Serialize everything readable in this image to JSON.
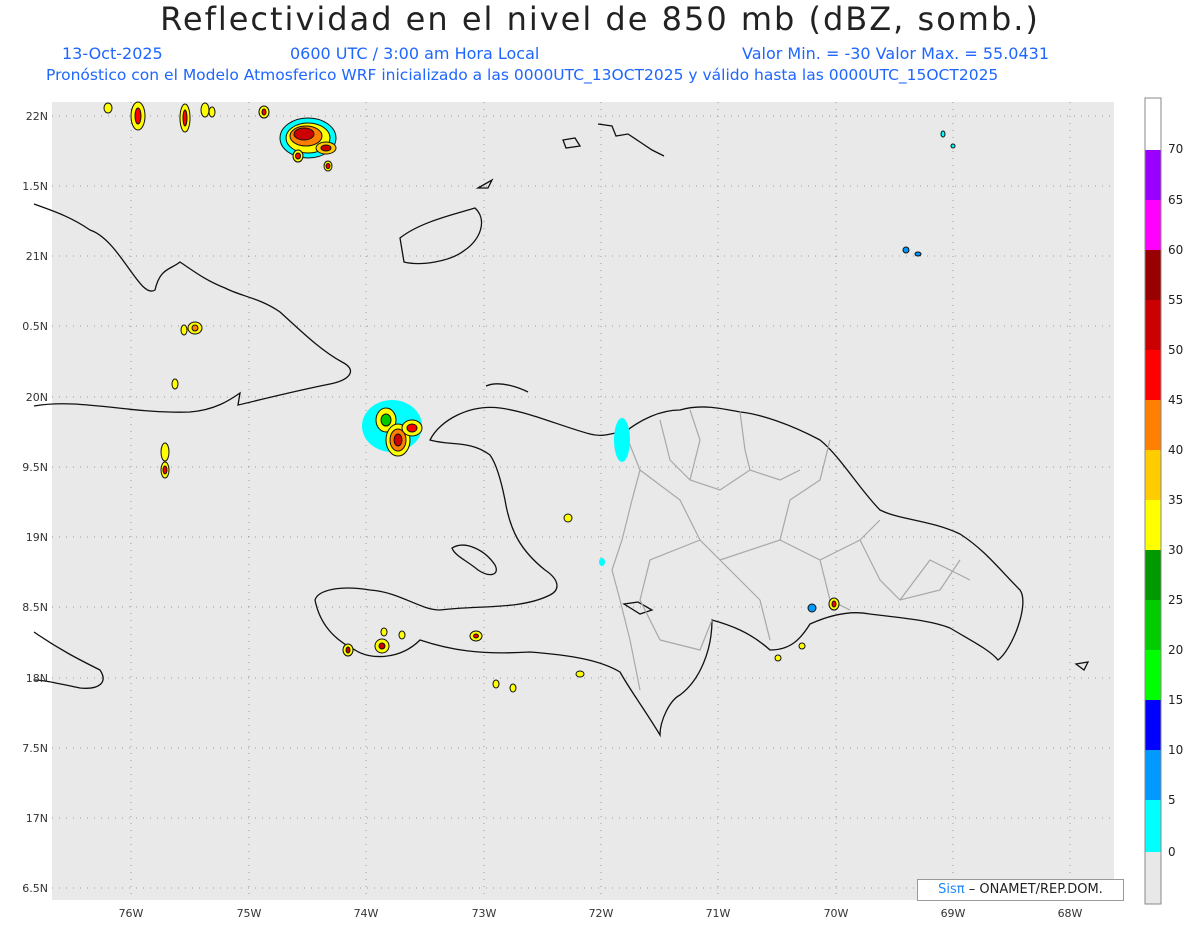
{
  "title": "Reflectividad en el nivel de 850 mb (dBZ, somb.)",
  "header": {
    "date": "13-Oct-2025",
    "time": "0600 UTC / 3:00 am Hora Local",
    "minmax": "Valor Min. = -30  Valor Max. = 55.0431",
    "forecast": "Pronóstico con el Modelo Atmosferico WRF inicializado a las 0000UTC_13OCT2025 y válido hasta las  0000UTC_15OCT2025"
  },
  "lat_labels": [
    "22N",
    "1.5N",
    "21N",
    "0.5N",
    "20N",
    "9.5N",
    "19N",
    "8.5N",
    "18N",
    "7.5N",
    "17N",
    "6.5N"
  ],
  "lon_labels": [
    "76W",
    "75W",
    "74W",
    "73W",
    "72W",
    "71W",
    "70W",
    "69W",
    "68W"
  ],
  "colorbar": {
    "labels": [
      "70",
      "65",
      "60",
      "55",
      "50",
      "45",
      "40",
      "35",
      "30",
      "25",
      "20",
      "15",
      "10",
      "5",
      "0"
    ],
    "colors": [
      "#ffffff",
      "#9900ff",
      "#ff00ff",
      "#990000",
      "#cc0000",
      "#ff0000",
      "#ff8000",
      "#ffcc00",
      "#ffff00",
      "#009900",
      "#00cc00",
      "#00ff00",
      "#0000ff",
      "#0099ff",
      "#00ffff",
      "#e8e8e8"
    ]
  },
  "credit": {
    "sis": "Sisπ",
    "org": "– ONAMET/REP.DOM."
  }
}
